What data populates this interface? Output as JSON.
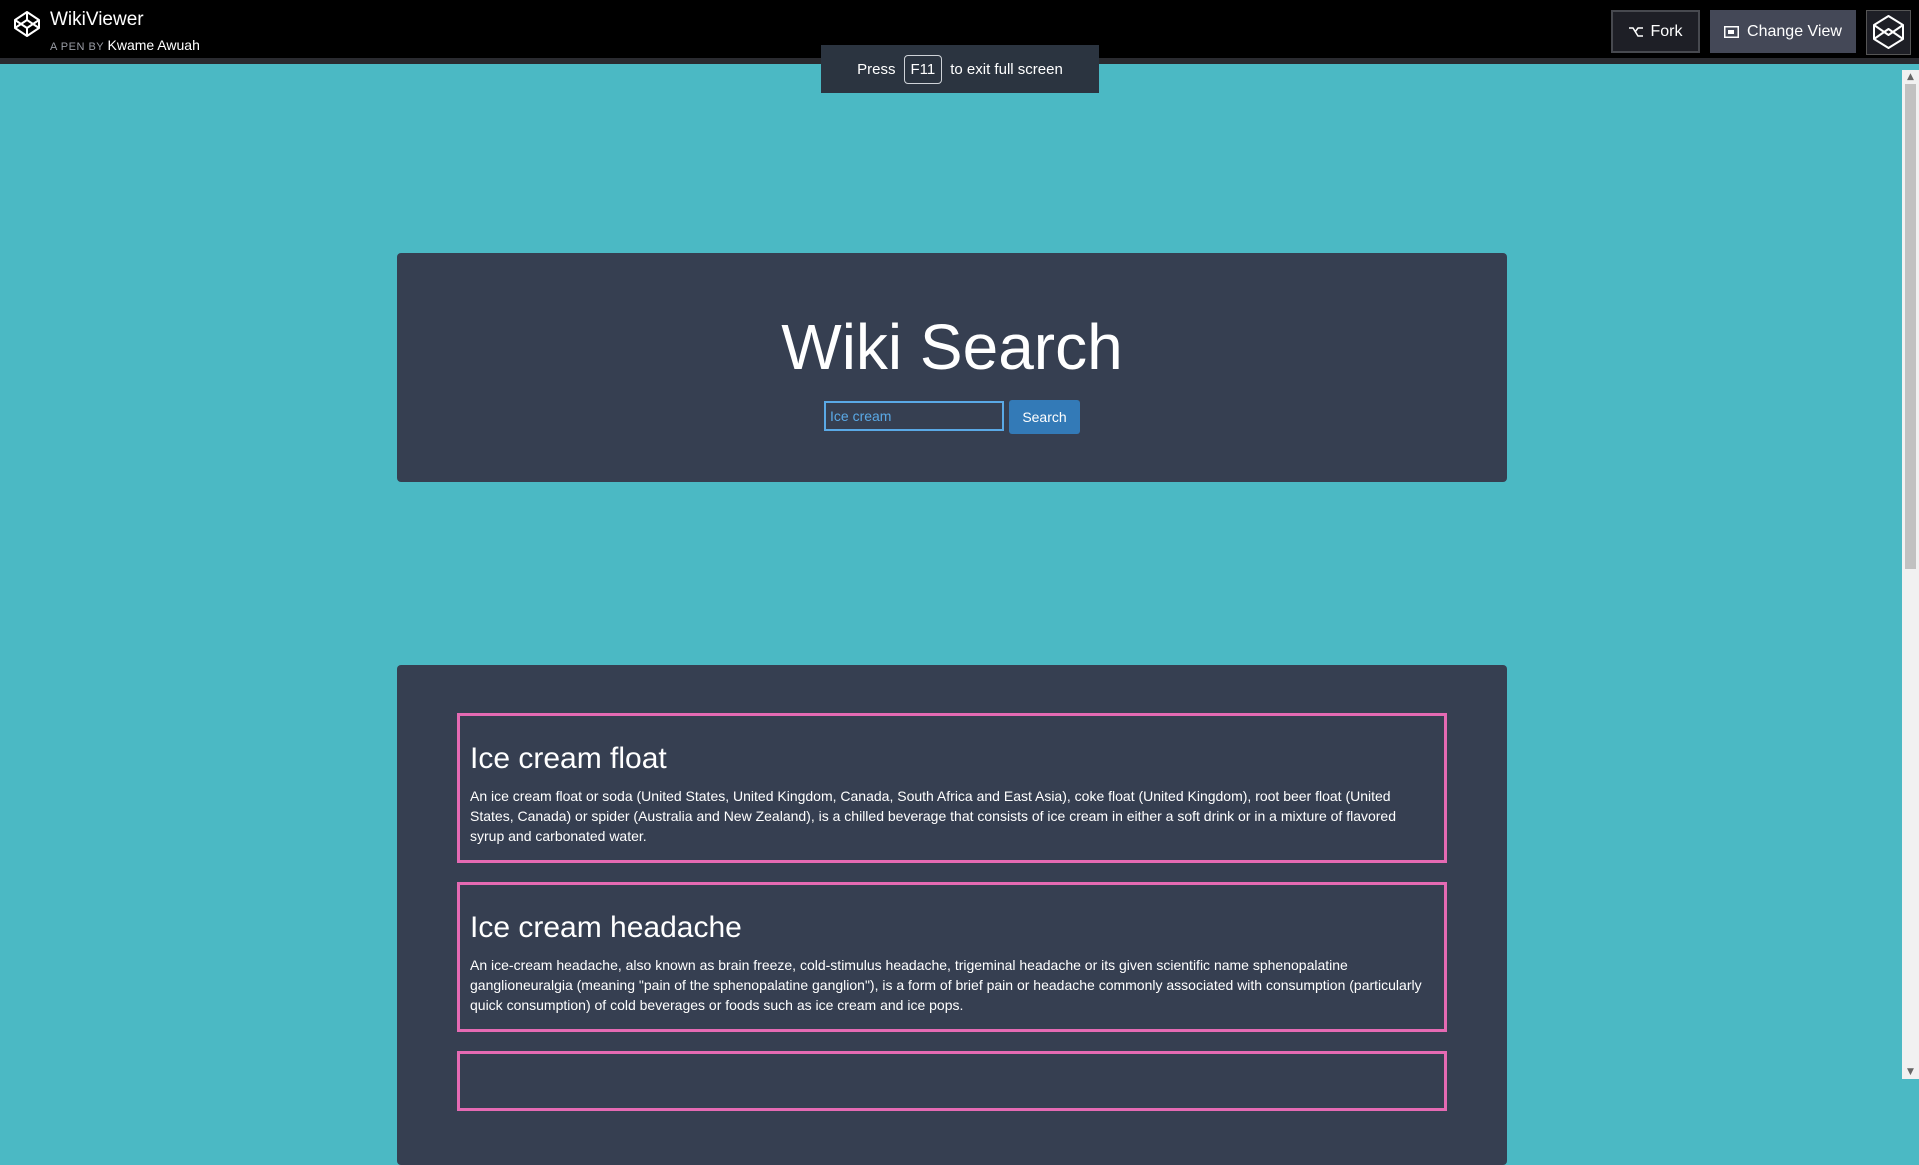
{
  "codepen": {
    "pen_title": "WikiViewer",
    "pen_by_label": "A PEN BY",
    "author": "Kwame Awuah",
    "fork_label": "Fork",
    "change_view_label": "Change View"
  },
  "fullscreen_toast": {
    "press": "Press",
    "key": "F11",
    "message": "to exit full screen"
  },
  "search": {
    "title": "Wiki Search",
    "input_value": "Ice cream",
    "button_label": "Search"
  },
  "results": [
    {
      "title": "Ice cream float",
      "snippet": "An ice cream float or soda (United States, United Kingdom, Canada, South Africa and East Asia), coke float (United Kingdom), root beer float (United States, Canada) or spider (Australia and New Zealand), is a chilled beverage that consists of ice cream in either a soft drink or in a mixture of flavored syrup and carbonated water."
    },
    {
      "title": "Ice cream headache",
      "snippet": "An ice-cream headache, also known as brain freeze, cold-stimulus headache, trigeminal headache or its given scientific name sphenopalatine ganglioneuralgia (meaning \"pain of the sphenopalatine ganglion\"), is a form of brief pain or headache commonly associated with consumption (particularly quick consumption) of cold beverages or foods such as ice cream and ice pops."
    }
  ],
  "colors": {
    "page_bg": "#4bb9c4",
    "panel_bg": "#363f51",
    "card_border": "#e56ab3",
    "button_blue": "#337ab7"
  }
}
